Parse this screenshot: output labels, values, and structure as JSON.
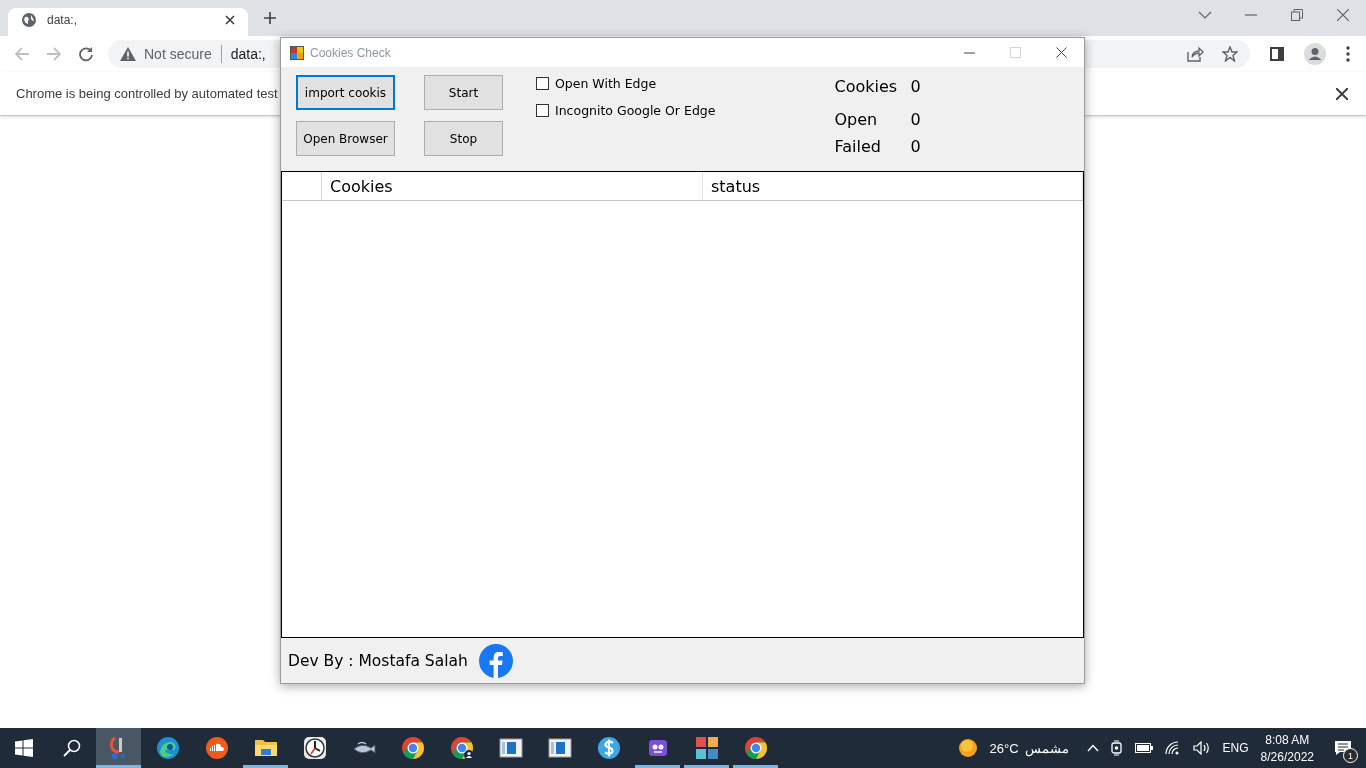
{
  "browser": {
    "tabs": [
      {
        "title": "data:,",
        "selected": true
      }
    ],
    "nav_buttons": [
      {
        "kind": "back",
        "disabled": true
      },
      {
        "kind": "forward",
        "disabled": true
      },
      {
        "kind": "reload",
        "disabled": false
      }
    ],
    "address_bar": {
      "security": "Not secure",
      "url": "data:,"
    },
    "infobar": {
      "message": "Chrome is being controlled by automated test"
    }
  },
  "app_window": {
    "title": "Cookies Check",
    "window_controls": [
      {
        "kind": "minimize",
        "disabled": false
      },
      {
        "kind": "maximize",
        "disabled": true
      },
      {
        "kind": "close",
        "disabled": false
      }
    ],
    "buttons": [
      {
        "label": "import cookis",
        "focused": true
      },
      {
        "label": "Start",
        "focused": false
      },
      {
        "label": "Open Browser",
        "focused": false
      },
      {
        "label": "Stop",
        "focused": false
      }
    ],
    "checkboxes": [
      {
        "label": "Open With Edge",
        "checked": false
      },
      {
        "label": "Incognito Google Or Edge",
        "checked": false
      }
    ],
    "stats": [
      {
        "label": "Cookies",
        "value": "0"
      },
      {
        "label": "Open",
        "value": "0"
      },
      {
        "label": "Failed",
        "value": "0"
      }
    ],
    "table": {
      "columns": [
        "Cookies",
        "status"
      ]
    },
    "footer": {
      "credit": "Dev By : Mostafa Salah"
    }
  },
  "taskbar": {
    "apps": [
      {
        "kind": "brush",
        "running": true,
        "selected": true
      },
      {
        "kind": "swirl",
        "running": false,
        "selected": false
      },
      {
        "kind": "cloud",
        "running": false,
        "selected": false
      },
      {
        "kind": "folder",
        "running": true,
        "selected": false
      },
      {
        "kind": "clock",
        "running": false,
        "selected": false
      },
      {
        "kind": "fish",
        "running": false,
        "selected": false
      },
      {
        "kind": "browser",
        "running": false,
        "selected": false
      },
      {
        "kind": "browser-profile",
        "running": false,
        "selected": false
      },
      {
        "kind": "window",
        "running": false,
        "selected": false
      },
      {
        "kind": "window",
        "running": false,
        "selected": false
      },
      {
        "kind": "dollar",
        "running": false,
        "selected": false
      },
      {
        "kind": "robot",
        "running": true,
        "selected": false
      },
      {
        "kind": "tiles",
        "running": true,
        "selected": false
      },
      {
        "kind": "browser",
        "running": true,
        "selected": false
      }
    ],
    "weather": {
      "temperature": "26°C",
      "condition": "مشمس"
    },
    "language": "ENG",
    "time": "8:08 AM",
    "date": "8/26/2022",
    "notifications": "1"
  }
}
